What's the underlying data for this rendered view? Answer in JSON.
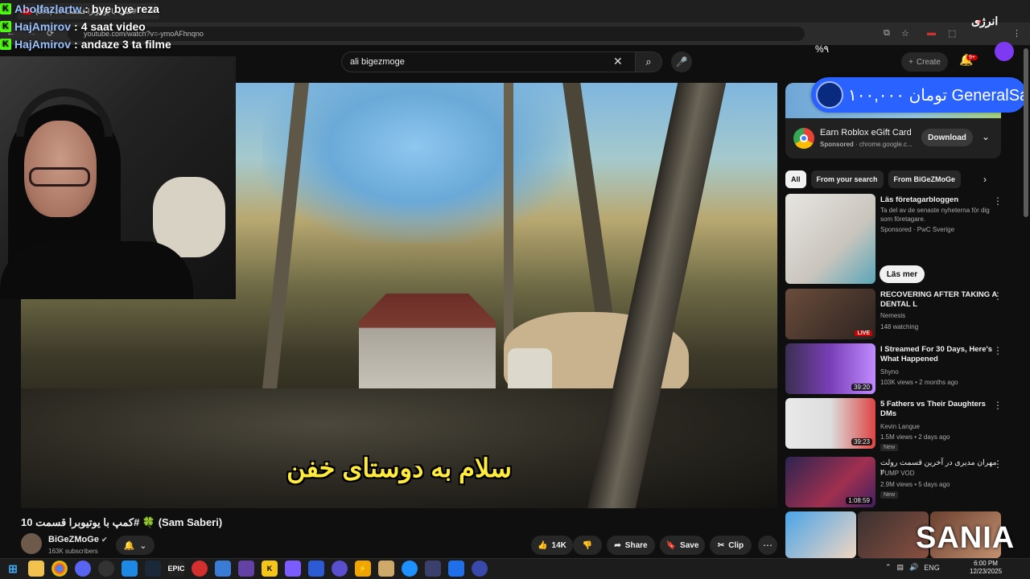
{
  "browser": {
    "tab_title": "(201) کمپ با یوتیوبرا قسمت 10#",
    "url": "youtube.com/watch?v=-ymoAFhnqno"
  },
  "chat": [
    {
      "user": "Abolfazlartw",
      "message": "bye bye reza"
    },
    {
      "user": "HajAmirov",
      "message": "4 saat video"
    },
    {
      "user": "HajAmirov",
      "message": "andaze 3 ta filme"
    }
  ],
  "overlay": {
    "energy_label": "انرژی",
    "percent": "%۹",
    "donation_text": "۱۰۰,۰۰۰ تومان GeneralSaeed",
    "watermark": "SANIA"
  },
  "youtube": {
    "search_value": "ali bigezmoge",
    "create_label": "Create",
    "notif_count": "9+",
    "video_subtitle": "سلام به دوستای خفن",
    "video_title": "کمپ با یوتیوبرا قسمت 10# 🍀 (Sam Saberi)",
    "channel_name": "BiGeZMoGe",
    "channel_subs": "163K subscribers",
    "like_count": "14K",
    "share_label": "Share",
    "save_label": "Save",
    "clip_label": "Clip"
  },
  "ad": {
    "title": "Earn Roblox eGift Card",
    "sponsored": "Sponsored",
    "domain": "chrome.google.c...",
    "button": "Download"
  },
  "chips": [
    "All",
    "From your search",
    "From BiGeZMoGe"
  ],
  "recommendations": [
    {
      "title": "Läs företagarbloggen",
      "meta1": "Ta del av de senaste nyheterna för dig som företagare.",
      "meta2": "Sponsored · PwC Sverige",
      "button": "Läs mer"
    },
    {
      "title": "RECOVERING  AFTER TAKING A DENTAL L",
      "meta1": "Nemesis",
      "meta2": "148 watching",
      "badge": "LIVE"
    },
    {
      "title": "I Streamed For 30 Days, Here's What Happened",
      "meta1": "Shyno",
      "meta2": "103K views • 2 months ago",
      "duration": "39:20"
    },
    {
      "title": "5 Fathers vs Their Daughters DMs",
      "meta1": "Kevin Langue",
      "meta2": "1.5M views • 2 days ago",
      "duration": "39:23",
      "new": "New"
    },
    {
      "title": "مهران مدیری در آخرین قسمت رولت ۲",
      "meta1": "PUMP VOD",
      "meta2": "2.9M views • 5 days ago",
      "duration": "1:08:59",
      "new": "New"
    }
  ],
  "taskbar": {
    "lang": "ENG",
    "time": "6:00 PM",
    "date": "12/23/2025"
  },
  "colors": {
    "accent": "#2962ff",
    "live": "#cc0000",
    "kick_green": "#53fc18"
  }
}
